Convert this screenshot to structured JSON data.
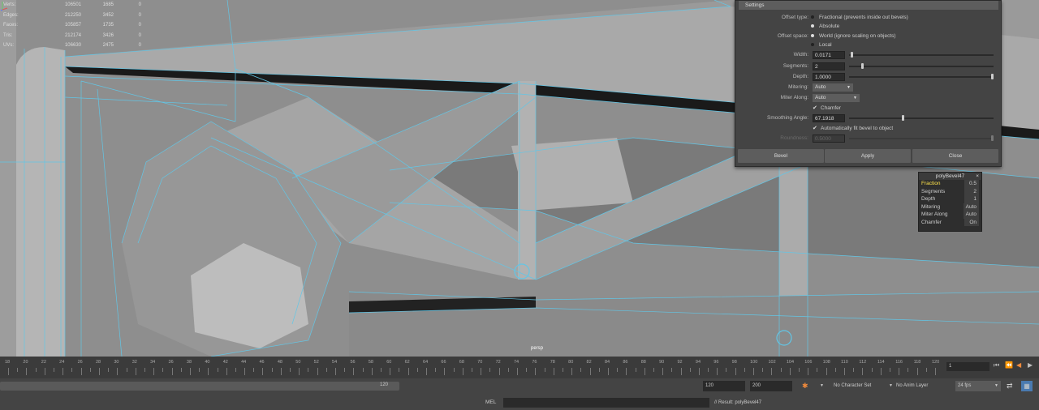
{
  "hud": {
    "rows": [
      {
        "label": "Verts:",
        "a": "106501",
        "b": "1685",
        "c": "0"
      },
      {
        "label": "Edges:",
        "a": "212250",
        "b": "3452",
        "c": "0"
      },
      {
        "label": "Faces:",
        "a": "105857",
        "b": "1735",
        "c": "0"
      },
      {
        "label": "Tris:",
        "a": "212174",
        "b": "3426",
        "c": "0"
      },
      {
        "label": "UVs:",
        "a": "106630",
        "b": "2475",
        "c": "0"
      }
    ]
  },
  "viewport": {
    "camera_label": "persp"
  },
  "settings": {
    "title": "Settings",
    "offset_type_label": "Offset type:",
    "offset_type_options": [
      "Fractional (prevents inside out bevels)",
      "Absolute"
    ],
    "offset_space_label": "Offset space:",
    "offset_space_options": [
      "World (ignore scaling on objects)",
      "Local"
    ],
    "width_label": "Width:",
    "width_value": "0.0171",
    "segments_label": "Segments:",
    "segments_value": "2",
    "depth_label": "Depth:",
    "depth_value": "1.0000",
    "mitering_label": "Mitering:",
    "mitering_value": "Auto",
    "miter_along_label": "Miter Along:",
    "miter_along_value": "Auto",
    "chamfer_label": "Chamfer",
    "smoothing_label": "Smoothing Angle:",
    "smoothing_value": "67.1918",
    "auto_fit_label": "Automatically fit bevel to object",
    "roundness_label": "Roundness:",
    "roundness_value": "0.5000",
    "buttons": {
      "bevel": "Bevel",
      "apply": "Apply",
      "close": "Close"
    }
  },
  "channel_box": {
    "title": "polyBevel47",
    "rows": [
      {
        "key": "Fraction",
        "value": "0.5"
      },
      {
        "key": "Segments",
        "value": "2"
      },
      {
        "key": "Depth",
        "value": "1"
      },
      {
        "key": "Mitering",
        "value": "Auto"
      },
      {
        "key": "Miter Along",
        "value": "Auto"
      },
      {
        "key": "Chamfer",
        "value": "On"
      }
    ]
  },
  "timeline": {
    "ticks": [
      "18",
      "20",
      "22",
      "24",
      "26",
      "28",
      "30",
      "32",
      "34",
      "36",
      "38",
      "40",
      "42",
      "44",
      "46",
      "48",
      "50",
      "52",
      "54",
      "56",
      "58",
      "60",
      "62",
      "64",
      "66",
      "68",
      "70",
      "72",
      "74",
      "76",
      "78",
      "80",
      "82",
      "84",
      "86",
      "88",
      "90",
      "92",
      "94",
      "96",
      "98",
      "100",
      "102",
      "104",
      "106",
      "108",
      "110",
      "112",
      "114",
      "116",
      "118",
      "120"
    ],
    "current_frame": "1"
  },
  "range": {
    "end_label": "120",
    "start_field": "120",
    "end_field": "200",
    "character_set": "No Character Set",
    "anim_layer": "No Anim Layer",
    "fps": "24 fps"
  },
  "command": {
    "mode": "MEL",
    "result": "// Result: polyBevel47"
  },
  "colors": {
    "wire": "#62c6e6",
    "viewport_bg": "#8f8f8f",
    "channel_highlight": "#ffe34a"
  }
}
